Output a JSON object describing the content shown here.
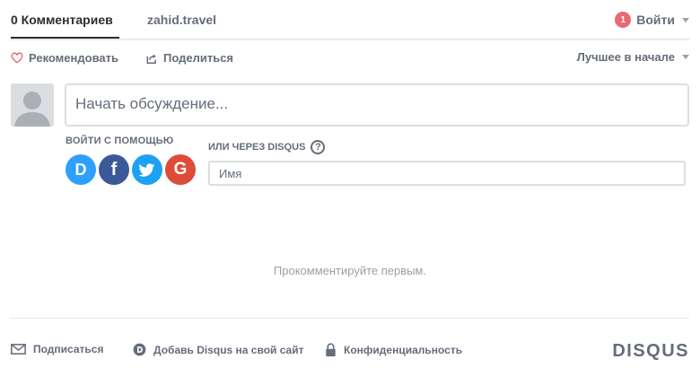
{
  "nav": {
    "tabs": [
      {
        "label": "0 Комментариев"
      },
      {
        "label": "zahid.travel"
      }
    ],
    "notification_count": "1",
    "login_label": "Войти"
  },
  "actions": {
    "recommend_label": "Рекомендовать",
    "share_label": "Поделиться",
    "sort_label": "Лучшее в начале"
  },
  "composer": {
    "placeholder": "Начать обсуждение..."
  },
  "auth": {
    "login_with_label": "ВОЙТИ С ПОМОЩЬЮ",
    "providers": [
      {
        "name": "Disqus",
        "glyph": "D",
        "color": "#2e9fff"
      },
      {
        "name": "Facebook",
        "glyph": "f",
        "color": "#3b5998"
      },
      {
        "name": "Twitter",
        "glyph": "t",
        "color": "#1da1f2"
      },
      {
        "name": "Google",
        "glyph": "G",
        "color": "#dd4b39"
      }
    ],
    "or_disqus_label": "ИЛИ ЧЕРЕЗ DISQUS",
    "help_glyph": "?",
    "name_placeholder": "Имя"
  },
  "empty_state": "Прокомментируйте первым.",
  "footer": {
    "subscribe_label": "Подписаться",
    "add_disqus_label": "Добавь Disqus на свой сайт",
    "privacy_label": "Конфиденциальность",
    "brand": "DISQUS"
  }
}
